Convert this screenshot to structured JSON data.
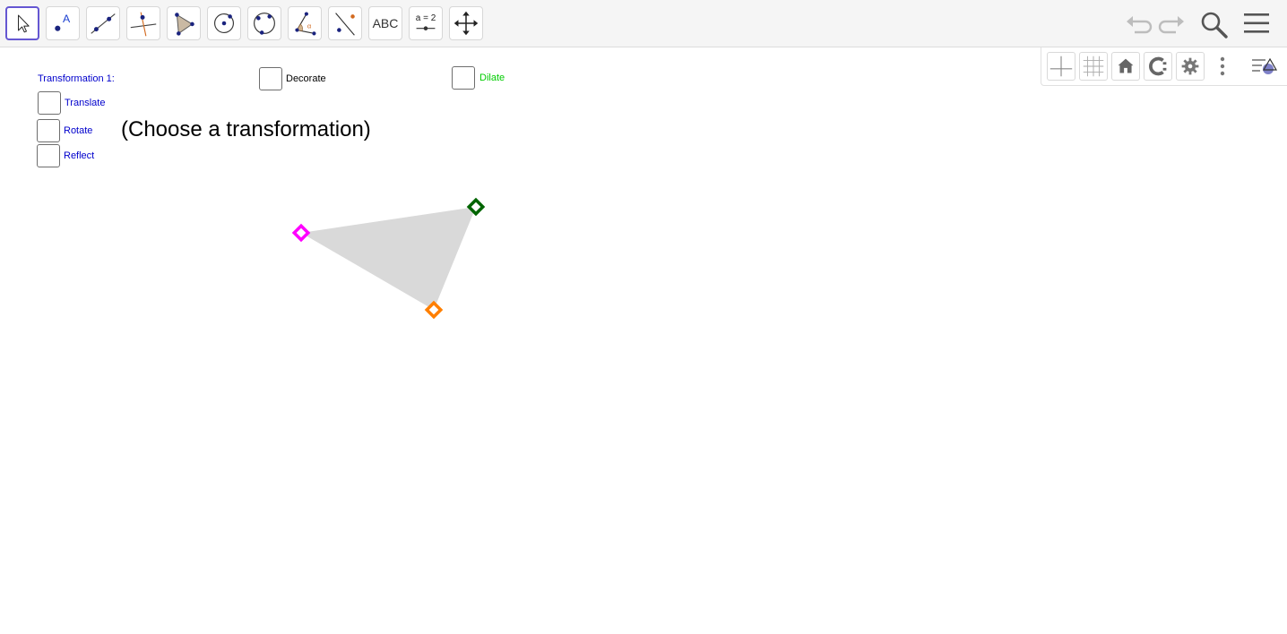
{
  "toolbar": {
    "tools": [
      {
        "name": "move-tool",
        "icon": "arrow-cursor-icon",
        "selected": true
      },
      {
        "name": "point-tool",
        "icon": "point-icon"
      },
      {
        "name": "line-tool",
        "icon": "line-icon"
      },
      {
        "name": "perpendicular-line-tool",
        "icon": "perpendicular-line-icon"
      },
      {
        "name": "polygon-tool",
        "icon": "polygon-icon"
      },
      {
        "name": "circle-center-point-tool",
        "icon": "circle-center-icon"
      },
      {
        "name": "circle-three-points-tool",
        "icon": "circle-three-points-icon"
      },
      {
        "name": "angle-tool",
        "icon": "angle-icon"
      },
      {
        "name": "reflect-about-line-tool",
        "icon": "reflect-line-icon"
      },
      {
        "name": "text-tool",
        "icon": "text-icon",
        "label": "ABC"
      },
      {
        "name": "slider-tool",
        "icon": "slider-icon",
        "label": "a = 2"
      },
      {
        "name": "move-graphics-view-tool",
        "icon": "move-view-icon"
      }
    ],
    "right": [
      "undo-icon",
      "redo-icon",
      "search-icon",
      "menu-icon"
    ]
  },
  "graphics_style_bar": {
    "buttons": [
      "axes-icon",
      "grid-icon",
      "home-icon",
      "point-capturing-icon",
      "gear-icon",
      "more-vertical-icon",
      "style-bar-toggle-icon"
    ]
  },
  "labels": {
    "transformation_title": "Transformation 1:",
    "choose_prompt": "(Choose a transformation)"
  },
  "checkboxes": {
    "decorate": {
      "label": "Decorate",
      "checked": false,
      "color": "#000000"
    },
    "dilate": {
      "label": "Dilate",
      "checked": false,
      "color": "#00cc00"
    },
    "translate": {
      "label": "Translate",
      "checked": false,
      "color": "#0000cc"
    },
    "rotate": {
      "label": "Rotate",
      "checked": false,
      "color": "#0000cc"
    },
    "reflect": {
      "label": "Reflect",
      "checked": false,
      "color": "#0000cc"
    }
  },
  "triangle": {
    "fill": "#d9d9d9",
    "vertices": [
      {
        "name": "vertex-magenta",
        "color": "#ff00ff"
      },
      {
        "name": "vertex-green",
        "color": "#006400"
      },
      {
        "name": "vertex-orange",
        "color": "#ff7f00"
      }
    ]
  },
  "colors": {
    "selected_tool_border": "#6557d2",
    "label_blue": "#0000cc"
  }
}
